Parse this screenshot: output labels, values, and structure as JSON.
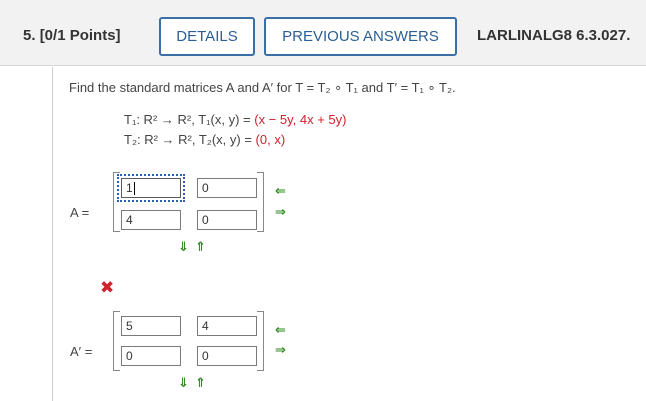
{
  "header": {
    "question_number": "5.",
    "points": "[0/1 Points]",
    "details_label": "DETAILS",
    "previous_answers_label": "PREVIOUS ANSWERS",
    "problem_code": "LARLINALG8 6.3.027."
  },
  "prompt": {
    "text": "Find the standard matrices A and A′ for T = T₂ ∘ T₁ and T′ = T₁ ∘ T₂."
  },
  "definitions": {
    "t1_lead": "T₁: R² → R², T₁(x, y) = ",
    "t1_value": "(x − 5y, 4x + 5y)",
    "t2_lead": "T₂: R² → R², T₂(x, y) = ",
    "t2_value": "(0, x)"
  },
  "matrix_a": {
    "label": "A =",
    "cells": [
      [
        "1",
        "0"
      ],
      [
        "4",
        "0"
      ]
    ]
  },
  "matrix_a_prime": {
    "label": "A′ =",
    "cells": [
      [
        "5",
        "4"
      ],
      [
        "0",
        "0"
      ]
    ],
    "status": "incorrect"
  },
  "icons": {
    "row_left": "⇐",
    "row_right": "⇒",
    "col_down": "⇓",
    "col_up": "⇑",
    "incorrect": "✖"
  },
  "colors": {
    "accent": "#2a5f94",
    "arrow_green": "#2e8b1e",
    "error_red": "#d0212c"
  }
}
